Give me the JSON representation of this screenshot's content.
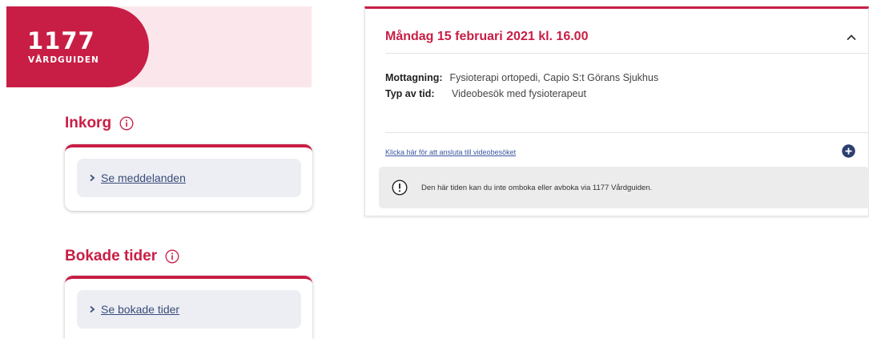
{
  "logo": {
    "number": "1177",
    "subtitle": "VÅRDGUIDEN"
  },
  "inbox": {
    "heading": "Inkorg",
    "link_label": "Se meddelanden"
  },
  "bookings": {
    "heading": "Bokade tider",
    "link_label": "Se bokade tider"
  },
  "appointment": {
    "title": "Måndag 15 februari 2021 kl. 16.00",
    "reception_label": "Mottagning:",
    "reception_value": "Fysioterapi ortopedi, Capio S:t Görans Sjukhus",
    "type_label": "Typ av tid:",
    "type_value": "Videobesök med fysioterapeut",
    "join_link": "Klicka här för att ansluta till videobesöket",
    "notice": "Den här tiden kan du inte omboka eller avboka via 1177 Vårdguiden."
  },
  "colors": {
    "brand_red": "#c81e45",
    "banner_pink": "#fbe7eb",
    "link_blue": "#394d7a",
    "button_bg": "#eceef3"
  },
  "icons": [
    "info-icon",
    "chevron-right-icon",
    "chevron-up-icon",
    "plus-circle-icon",
    "warning-icon"
  ]
}
